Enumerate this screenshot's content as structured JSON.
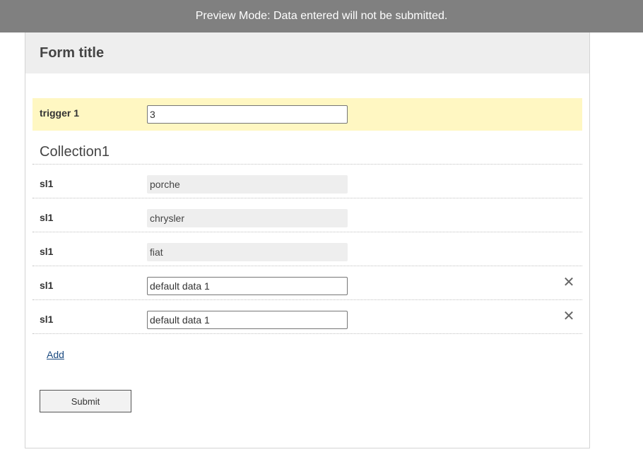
{
  "banner": {
    "text": "Preview Mode: Data entered will not be submitted."
  },
  "form": {
    "title": "Form title",
    "trigger": {
      "label": "trigger 1",
      "value": "3"
    },
    "collection": {
      "title": "Collection1",
      "items": [
        {
          "label": "sl1",
          "value": "porche",
          "readonly": true,
          "removable": false
        },
        {
          "label": "sl1",
          "value": "chrysler",
          "readonly": true,
          "removable": false
        },
        {
          "label": "sl1",
          "value": "fiat",
          "readonly": true,
          "removable": false
        },
        {
          "label": "sl1",
          "value": "default data 1",
          "readonly": false,
          "removable": true,
          "remove_glyph": "✕"
        },
        {
          "label": "sl1",
          "value": "default data 1",
          "readonly": false,
          "removable": true,
          "remove_glyph": "✕"
        }
      ],
      "add_label": "Add"
    },
    "submit_label": "Submit"
  },
  "icons": {
    "remove": "close-icon"
  },
  "colors": {
    "banner_bg": "#808080",
    "header_bg": "#eeeeee",
    "trigger_highlight": "#fff7c2",
    "readonly_bg": "#eeeeee",
    "link": "#1a4a80"
  }
}
